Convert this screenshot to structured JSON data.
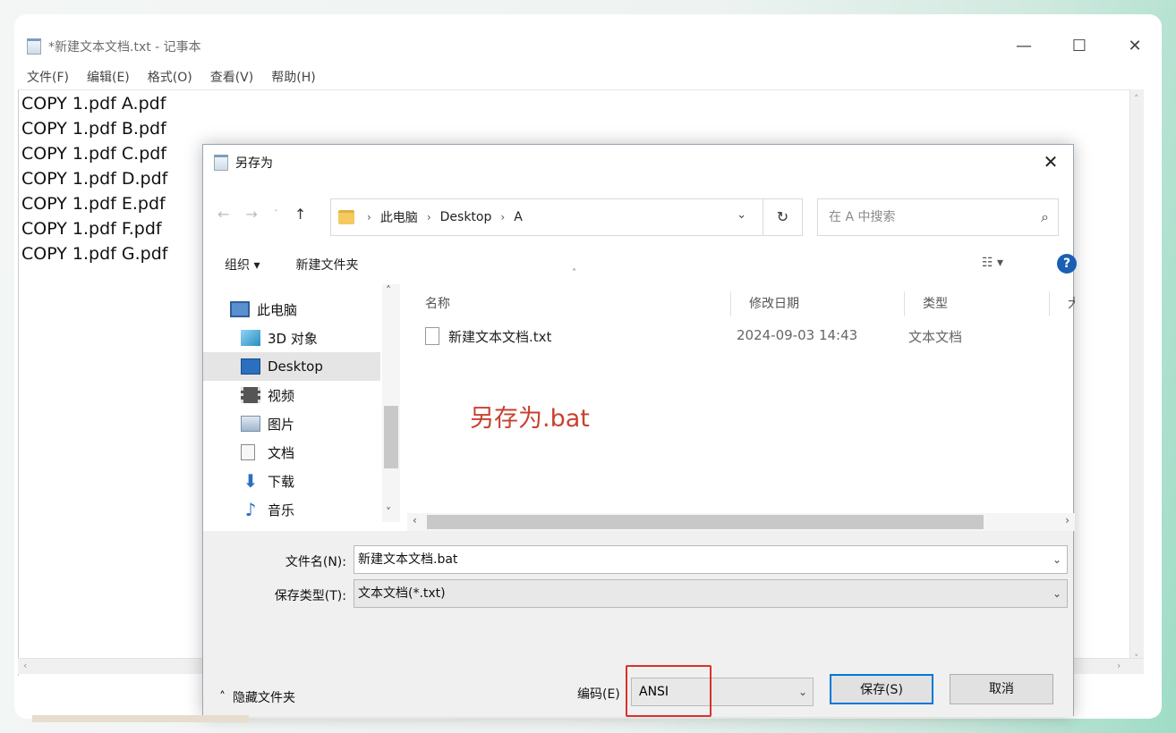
{
  "notepad": {
    "title": "*新建文本文档.txt - 记事本",
    "window_controls": [
      "—",
      "☐",
      "✕"
    ],
    "menu": [
      "文件(F)",
      "编辑(E)",
      "格式(O)",
      "查看(V)",
      "帮助(H)"
    ],
    "lines": [
      "COPY 1.pdf A.pdf",
      "COPY 1.pdf B.pdf",
      "COPY 1.pdf C.pdf",
      "COPY 1.pdf D.pdf",
      "COPY 1.pdf E.pdf",
      "COPY 1.pdf F.pdf",
      "COPY 1.pdf G.pdf"
    ]
  },
  "dialog": {
    "title": "另存为",
    "close": "✕",
    "breadcrumb": [
      "此电脑",
      "Desktop",
      "A"
    ],
    "search_placeholder": "在 A 中搜索",
    "toolbar": {
      "organize": "组织 ▾",
      "new_folder": "新建文件夹"
    },
    "nav_items": [
      {
        "label": "此电脑",
        "icon": "computer-icon"
      },
      {
        "label": "3D 对象",
        "icon": "cube-icon"
      },
      {
        "label": "Desktop",
        "icon": "desktop-icon"
      },
      {
        "label": "视频",
        "icon": "video-icon"
      },
      {
        "label": "图片",
        "icon": "picture-icon"
      },
      {
        "label": "文档",
        "icon": "document-icon"
      },
      {
        "label": "下载",
        "icon": "download-icon"
      },
      {
        "label": "音乐",
        "icon": "music-icon"
      }
    ],
    "columns": [
      "名称",
      "修改日期",
      "类型",
      "大小"
    ],
    "files": [
      {
        "name": "新建文本文档.txt",
        "date": "2024-09-03 14:43",
        "type": "文本文档"
      }
    ],
    "annotation": "另存为.bat",
    "filename_label": "文件名(N):",
    "filename_value": "新建文本文档.bat",
    "filetype_label": "保存类型(T):",
    "filetype_value": "文本文档(*.txt)",
    "hide_folders": "隐藏文件夹",
    "encoding_label": "编码(E)",
    "encoding_value": "ANSI",
    "save_button": "保存(S)",
    "cancel_button": "取消"
  }
}
